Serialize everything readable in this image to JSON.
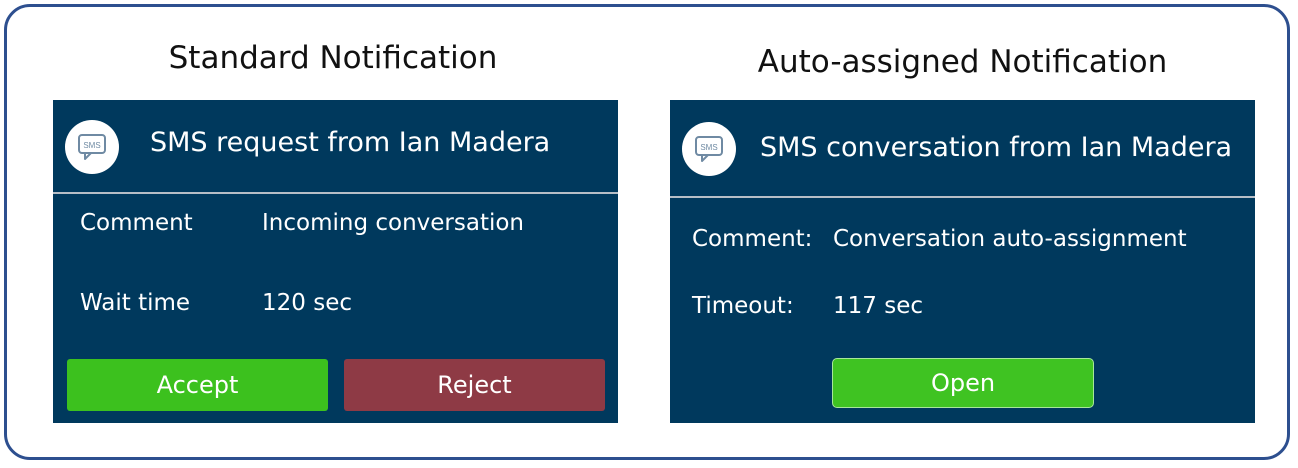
{
  "standard": {
    "heading": "Standard Notification",
    "title": "SMS request from Ian Madera",
    "icon": "sms-chat-icon",
    "comment_label": "Comment",
    "comment_value": "Incoming  conversation",
    "wait_label": "Wait time",
    "wait_value": "120 sec",
    "accept_label": "Accept",
    "reject_label": "Reject"
  },
  "auto": {
    "heading": "Auto-assigned Notification",
    "title": "SMS conversation from Ian Madera",
    "icon": "sms-chat-icon",
    "comment_label": "Comment:",
    "comment_value": "Conversation auto-assignment",
    "timeout_label": "Timeout:",
    "timeout_value": "117 sec",
    "open_label": "Open"
  },
  "icon_text": "SMS",
  "colors": {
    "card_background": "#00395d",
    "accept": "#3cc11e",
    "reject": "#8e3a45",
    "open": "#3fc322",
    "frame_border": "#2d4f8f"
  }
}
